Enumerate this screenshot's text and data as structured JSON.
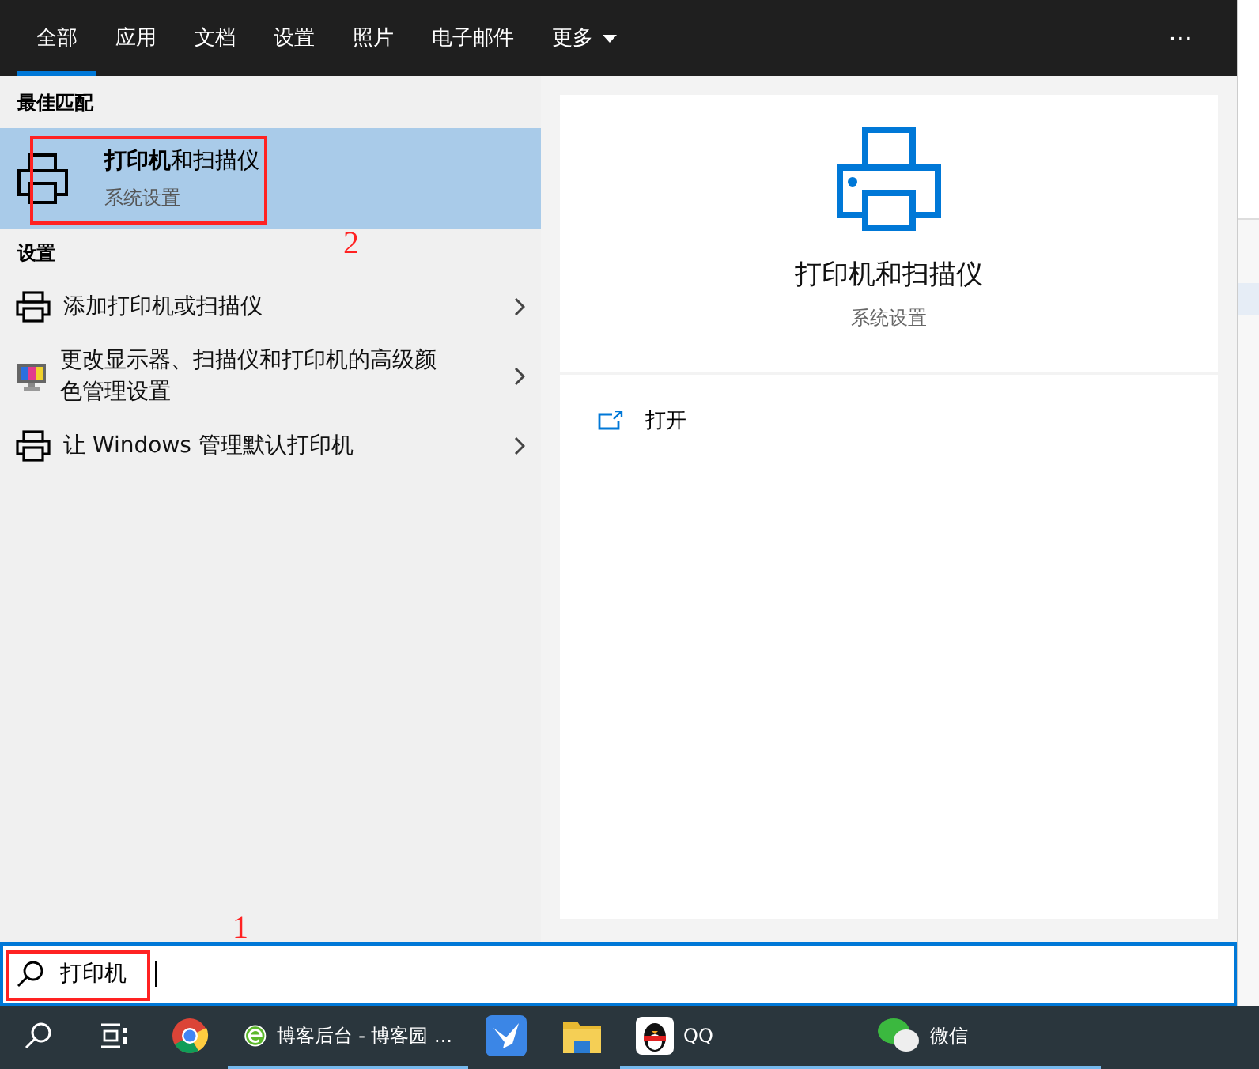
{
  "tabs": [
    {
      "label": "全部",
      "selected": true
    },
    {
      "label": "应用",
      "selected": false
    },
    {
      "label": "文档",
      "selected": false
    },
    {
      "label": "设置",
      "selected": false
    },
    {
      "label": "照片",
      "selected": false
    },
    {
      "label": "电子邮件",
      "selected": false
    },
    {
      "label": "更多",
      "selected": false,
      "dropdown": true
    }
  ],
  "more_menu": "···",
  "best_match": {
    "heading": "最佳匹配",
    "title": "**打印机**和扫描仪",
    "subtitle": "系统设置",
    "selected": true
  },
  "settings": {
    "heading": "设置",
    "items": [
      {
        "kind": "printer",
        "label": "添加打印机或扫描仪"
      },
      {
        "kind": "monitor",
        "label": "更改显示器、扫描仪和打印机的高级颜色管理设置"
      },
      {
        "kind": "printer",
        "label": "让 Windows 管理默认打印机"
      }
    ]
  },
  "preview": {
    "title": "打印机和扫描仪",
    "subtitle": "系统设置",
    "actions": [
      {
        "label": "打开"
      }
    ]
  },
  "search": {
    "value": "打印机"
  },
  "annotations": {
    "best_match_number": "2",
    "search_number": "1"
  },
  "taskbar": [
    {
      "kind": "search",
      "running": false
    },
    {
      "kind": "taskview",
      "running": false
    },
    {
      "kind": "chrome",
      "running": false
    },
    {
      "kind": "ie",
      "label": "博客后台 - 博客园 ...",
      "running": true
    },
    {
      "kind": "bird",
      "running": false
    },
    {
      "kind": "explorer",
      "running": false
    },
    {
      "kind": "qq",
      "label": "QQ",
      "running": true
    },
    {
      "kind": "wechat",
      "label": "微信",
      "running": true
    }
  ]
}
